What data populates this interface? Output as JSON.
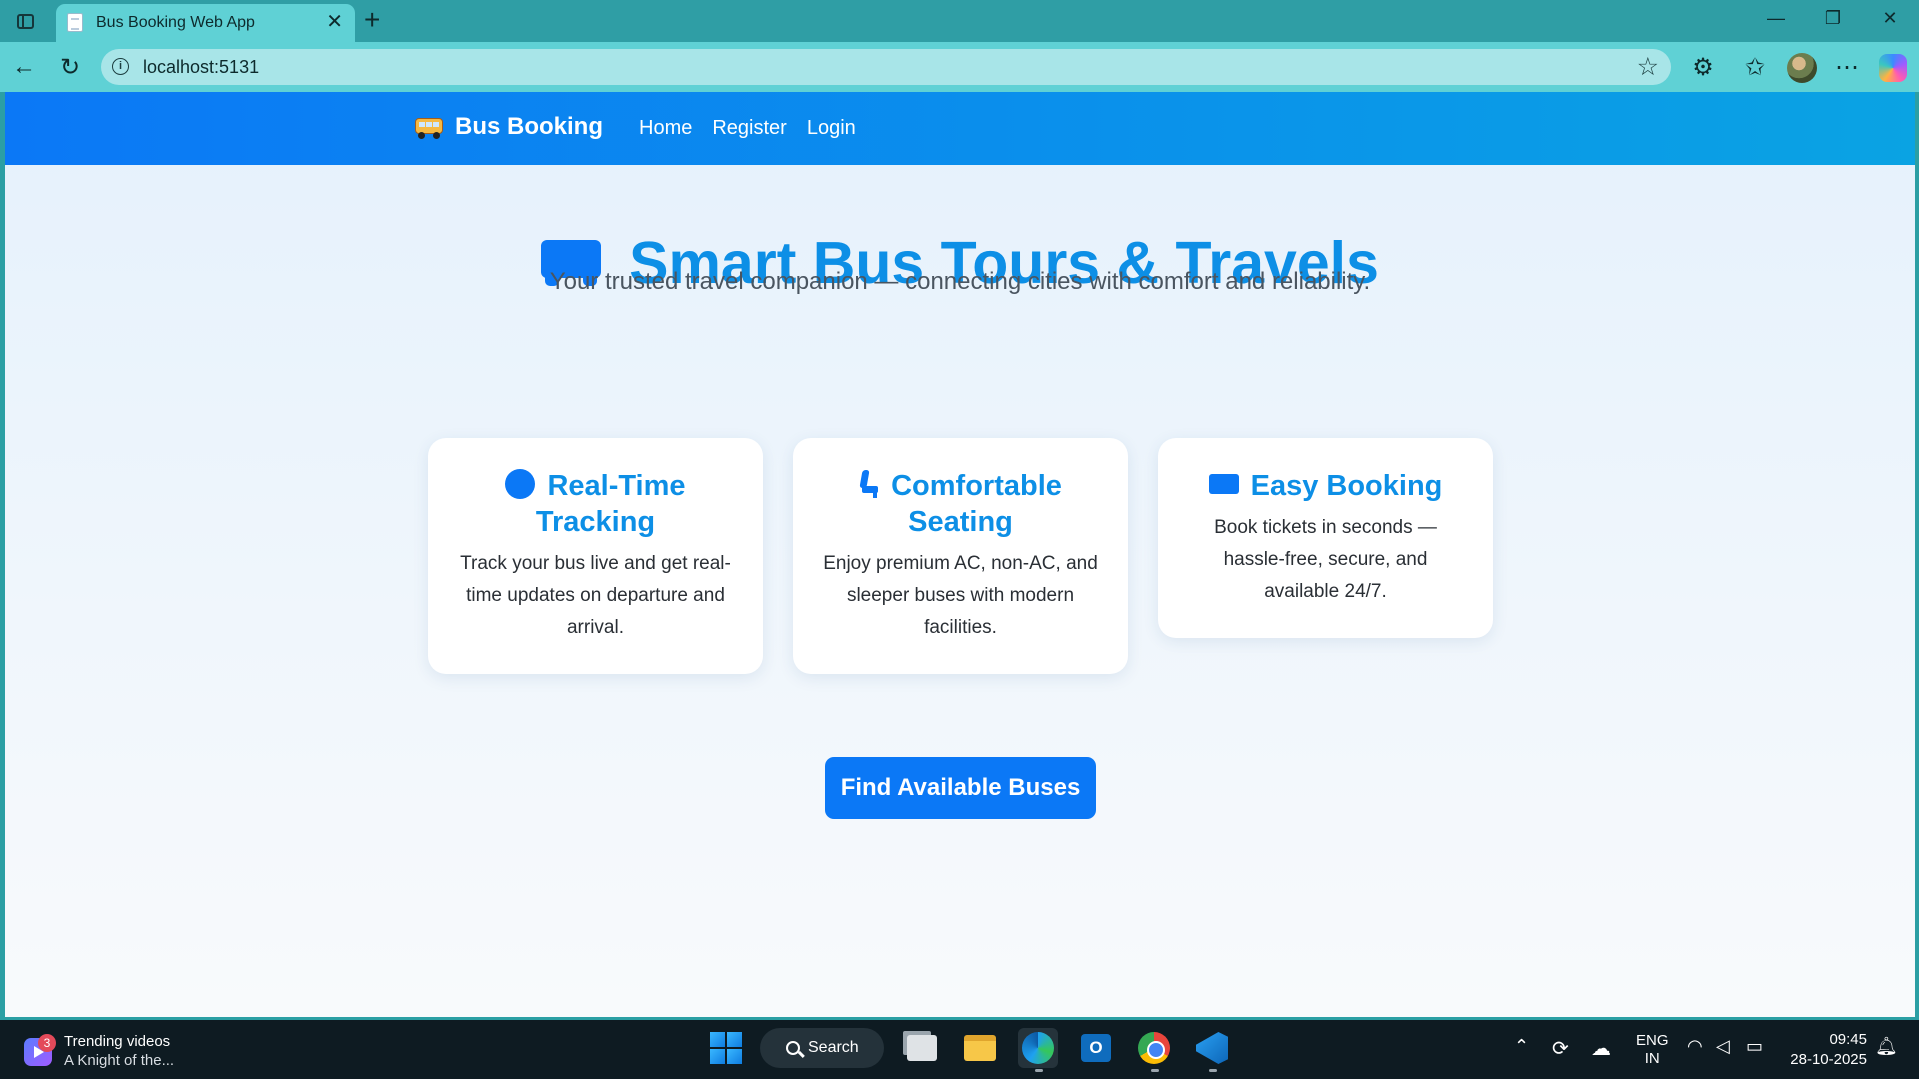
{
  "browser": {
    "tab_title": "Bus Booking Web App",
    "tab_close": "✕",
    "new_tab": "+",
    "window_controls": [
      "—",
      "❐",
      "✕"
    ],
    "url": "localhost:5131"
  },
  "navbar": {
    "brand": "Bus Booking",
    "links": [
      "Home",
      "Register",
      "Login"
    ]
  },
  "hero": {
    "title": "Smart Bus Tours & Travels",
    "subtitle": "Your trusted travel companion — connecting cities with comfort and reliability."
  },
  "features": [
    {
      "icon": "location-dot-icon",
      "title": "Real-Time Tracking",
      "text": "Track your bus live and get real-time updates on departure and arrival."
    },
    {
      "icon": "seat-icon",
      "title": "Comfortable Seating",
      "text": "Enjoy premium AC, non-AC, and sleeper buses with modern facilities."
    },
    {
      "icon": "ticket-icon",
      "title": "Easy Booking",
      "text": "Book tickets in seconds — hassle-free, secure, and available 24/7."
    }
  ],
  "cta": {
    "label": "Find Available Buses"
  },
  "taskbar": {
    "widget_badge": "3",
    "widget_title": "Trending videos",
    "widget_subtitle": "A Knight of the...",
    "search_label": "Search",
    "language_top": "ENG",
    "language_bottom": "IN",
    "time": "09:45",
    "date": "28-10-2025"
  },
  "colors": {
    "primary": "#0b78f6",
    "heading": "#0d8fe6",
    "navbar_gradient_start": "#0b78f6",
    "navbar_gradient_end": "#0aa3e3",
    "browser_chrome": "#5fd1d5"
  }
}
